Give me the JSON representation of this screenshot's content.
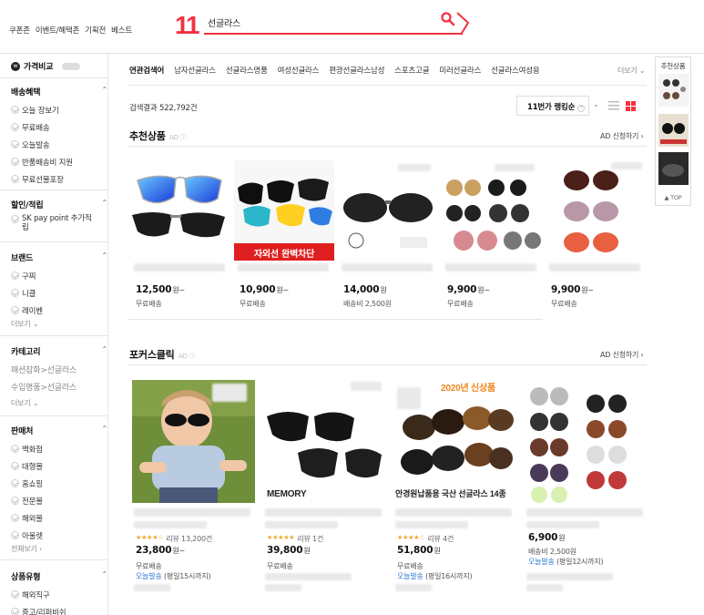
{
  "topnav": {
    "items": [
      "쿠폰존",
      "이벤트/혜택존",
      "기획전",
      "베스트"
    ]
  },
  "logo": {
    "text": "11"
  },
  "search": {
    "query": "선글라스"
  },
  "sidebar": {
    "compare": {
      "label": "가격비교"
    },
    "sections": [
      {
        "title": "배송혜택",
        "items": [
          "오늘 장보기",
          "무료배송",
          "오늘발송",
          "반품배송비 지원",
          "무료선물포장"
        ]
      },
      {
        "title": "할인/적립",
        "items": [
          "SK pay point 추가적립"
        ]
      },
      {
        "title": "브랜드",
        "items": [
          "구찌",
          "니클",
          "레이벤"
        ],
        "more": "더보기"
      },
      {
        "title": "카테고리",
        "paths": [
          "패션잡화>선글라스",
          "수입명품>선글라스"
        ],
        "more": "더보기"
      },
      {
        "title": "판매처",
        "items": [
          "백화점",
          "대형몰",
          "홈쇼핑",
          "전문몰",
          "해외몰",
          "아울렛"
        ],
        "more": "전체보기"
      },
      {
        "title": "상품유형",
        "items": [
          "해외직구",
          "중고/리퍼비쉬"
        ]
      }
    ]
  },
  "related": {
    "label": "연관검색어",
    "terms": [
      "남자선글라스",
      "선글라스명품",
      "여성선글라스",
      "편광선글라스남성",
      "스포츠고글",
      "미러선글라스",
      "선글라스여성용"
    ],
    "more": "더보기"
  },
  "results": {
    "count_text": "검색결과 522,792건",
    "sort": "11번가 랭킹순"
  },
  "recommended": {
    "title": "추천상품",
    "ad": "AD 신청하기",
    "items": [
      {
        "price": "12,500",
        "unit": "원~",
        "shipping": "무료배송"
      },
      {
        "price": "10,900",
        "unit": "원~",
        "shipping": "무료배송",
        "badge": "자외선 완벽차단"
      },
      {
        "price": "14,000",
        "unit": "원",
        "shipping": "배송비 2,500원"
      },
      {
        "price": "9,900",
        "unit": "원~",
        "shipping": "무료배송"
      },
      {
        "price": "9,900",
        "unit": "원~",
        "shipping": "무료배송"
      }
    ]
  },
  "focus": {
    "title": "포커스클릭",
    "ad": "AD 신청하기",
    "items": [
      {
        "rating": 4.5,
        "review": "리뷰 13,200건",
        "price": "23,800",
        "unit": "원~",
        "shipping": "무료배송",
        "today": "오늘발송",
        "today_note": "(평일15시까지)"
      },
      {
        "rating": 5,
        "review": "리뷰 1건",
        "price": "39,800",
        "unit": "원",
        "shipping": "무료배송",
        "brand_text": "MEMORY"
      },
      {
        "rating": 4.5,
        "review": "리뷰 4건",
        "price": "51,800",
        "unit": "원",
        "shipping": "무료배송",
        "today": "오늘발송",
        "today_note": "(평일16시까지)",
        "top_text": "2020년 신상품",
        "caption": "안경원납품용 국산 선글라스 14종"
      },
      {
        "price": "6,900",
        "unit": "원",
        "shipping": "배송비 2,500원",
        "today": "오늘발송",
        "today_note": "(평일12시까지)"
      }
    ]
  },
  "rail": {
    "title": "추천상품",
    "top": "TOP"
  },
  "colors": {
    "brand": "#f43142",
    "link": "#2b7bd6",
    "star": "#f5a623"
  }
}
